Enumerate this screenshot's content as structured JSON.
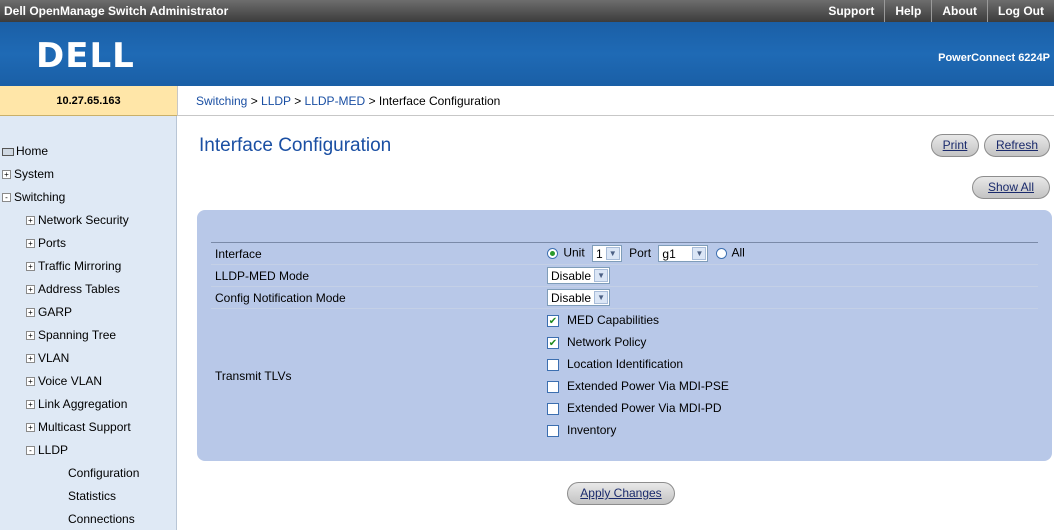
{
  "topbar": {
    "app_title": "Dell OpenManage Switch Administrator",
    "links": [
      "Support",
      "Help",
      "About",
      "Log Out"
    ]
  },
  "brand": {
    "logo_text": "DELL",
    "model": "PowerConnect 6224P"
  },
  "ip_address": "10.27.65.163",
  "breadcrumb": {
    "items": [
      "Switching",
      "LLDP",
      "LLDP-MED"
    ],
    "separator": " > ",
    "current": "Interface Configuration"
  },
  "sidebar": {
    "items": [
      {
        "label": "Home",
        "icon": "home-icon",
        "level": 0
      },
      {
        "label": "System",
        "expander": "+",
        "level": 0
      },
      {
        "label": "Switching",
        "expander": "-",
        "level": 0
      },
      {
        "label": "Network Security",
        "expander": "+",
        "level": 1
      },
      {
        "label": "Ports",
        "expander": "+",
        "level": 1
      },
      {
        "label": "Traffic Mirroring",
        "expander": "+",
        "level": 1
      },
      {
        "label": "Address Tables",
        "expander": "+",
        "level": 1
      },
      {
        "label": "GARP",
        "expander": "+",
        "level": 1
      },
      {
        "label": "Spanning Tree",
        "expander": "+",
        "level": 1
      },
      {
        "label": "VLAN",
        "expander": "+",
        "level": 1
      },
      {
        "label": "Voice VLAN",
        "expander": "+",
        "level": 1
      },
      {
        "label": "Link Aggregation",
        "expander": "+",
        "level": 1
      },
      {
        "label": "Multicast Support",
        "expander": "+",
        "level": 1
      },
      {
        "label": "LLDP",
        "expander": "-",
        "level": 1
      },
      {
        "label": "Configuration",
        "level": 2
      },
      {
        "label": "Statistics",
        "level": 2
      },
      {
        "label": "Connections",
        "level": 2
      }
    ]
  },
  "main": {
    "title": "Interface Configuration",
    "print_label": "Print",
    "refresh_label": "Refresh",
    "show_all_label": "Show All",
    "apply_label": "Apply Changes",
    "form": {
      "interface": {
        "label": "Interface",
        "unit_label": "Unit",
        "unit_value": "1",
        "port_label": "Port",
        "port_value": "g1",
        "all_label": "All"
      },
      "lldp_med_mode": {
        "label": "LLDP-MED Mode",
        "value": "Disable"
      },
      "config_notification_mode": {
        "label": "Config Notification Mode",
        "value": "Disable"
      },
      "transmit_tlvs": {
        "label": "Transmit TLVs",
        "options": [
          {
            "label": "MED Capabilities",
            "checked": true
          },
          {
            "label": "Network Policy",
            "checked": true
          },
          {
            "label": "Location Identification",
            "checked": false
          },
          {
            "label": "Extended Power Via MDI-PSE",
            "checked": false
          },
          {
            "label": "Extended Power Via MDI-PD",
            "checked": false
          },
          {
            "label": "Inventory",
            "checked": false
          }
        ]
      }
    }
  }
}
